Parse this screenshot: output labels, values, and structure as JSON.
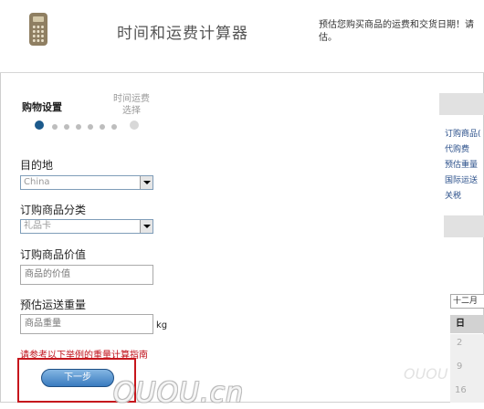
{
  "header": {
    "title": "时间和运费计算器",
    "description": "预估您购买商品的运费和交货日期！请估。",
    "icon": "calculator-icon"
  },
  "steps": {
    "step1": "购物设置",
    "step2_line1": "时间运费",
    "step2_line2": "选择"
  },
  "form": {
    "destination_label": "目的地",
    "destination_value": "China",
    "category_label": "订购商品分类",
    "category_value": "礼品卡",
    "value_label": "订购商品价值",
    "value_placeholder": "商品的价值",
    "weight_label": "预估运送重量",
    "weight_placeholder": "商品重量",
    "weight_unit": "kg",
    "guide_text": "请参考以下举例的重量计算指南",
    "next_button": "下一步"
  },
  "sidebar": {
    "links": [
      "订购商品(",
      "代购费",
      "预估重量",
      "国际运送",
      "关税"
    ]
  },
  "calendar": {
    "month": "十二月",
    "day_header": "日",
    "dates": [
      "2",
      "9",
      "16"
    ]
  },
  "watermark": "OUOU.cn",
  "watermark2": "OUOU",
  "colors": {
    "accent": "#1c5a8c",
    "warning": "#c0101a",
    "highlight": "#c6161c"
  }
}
